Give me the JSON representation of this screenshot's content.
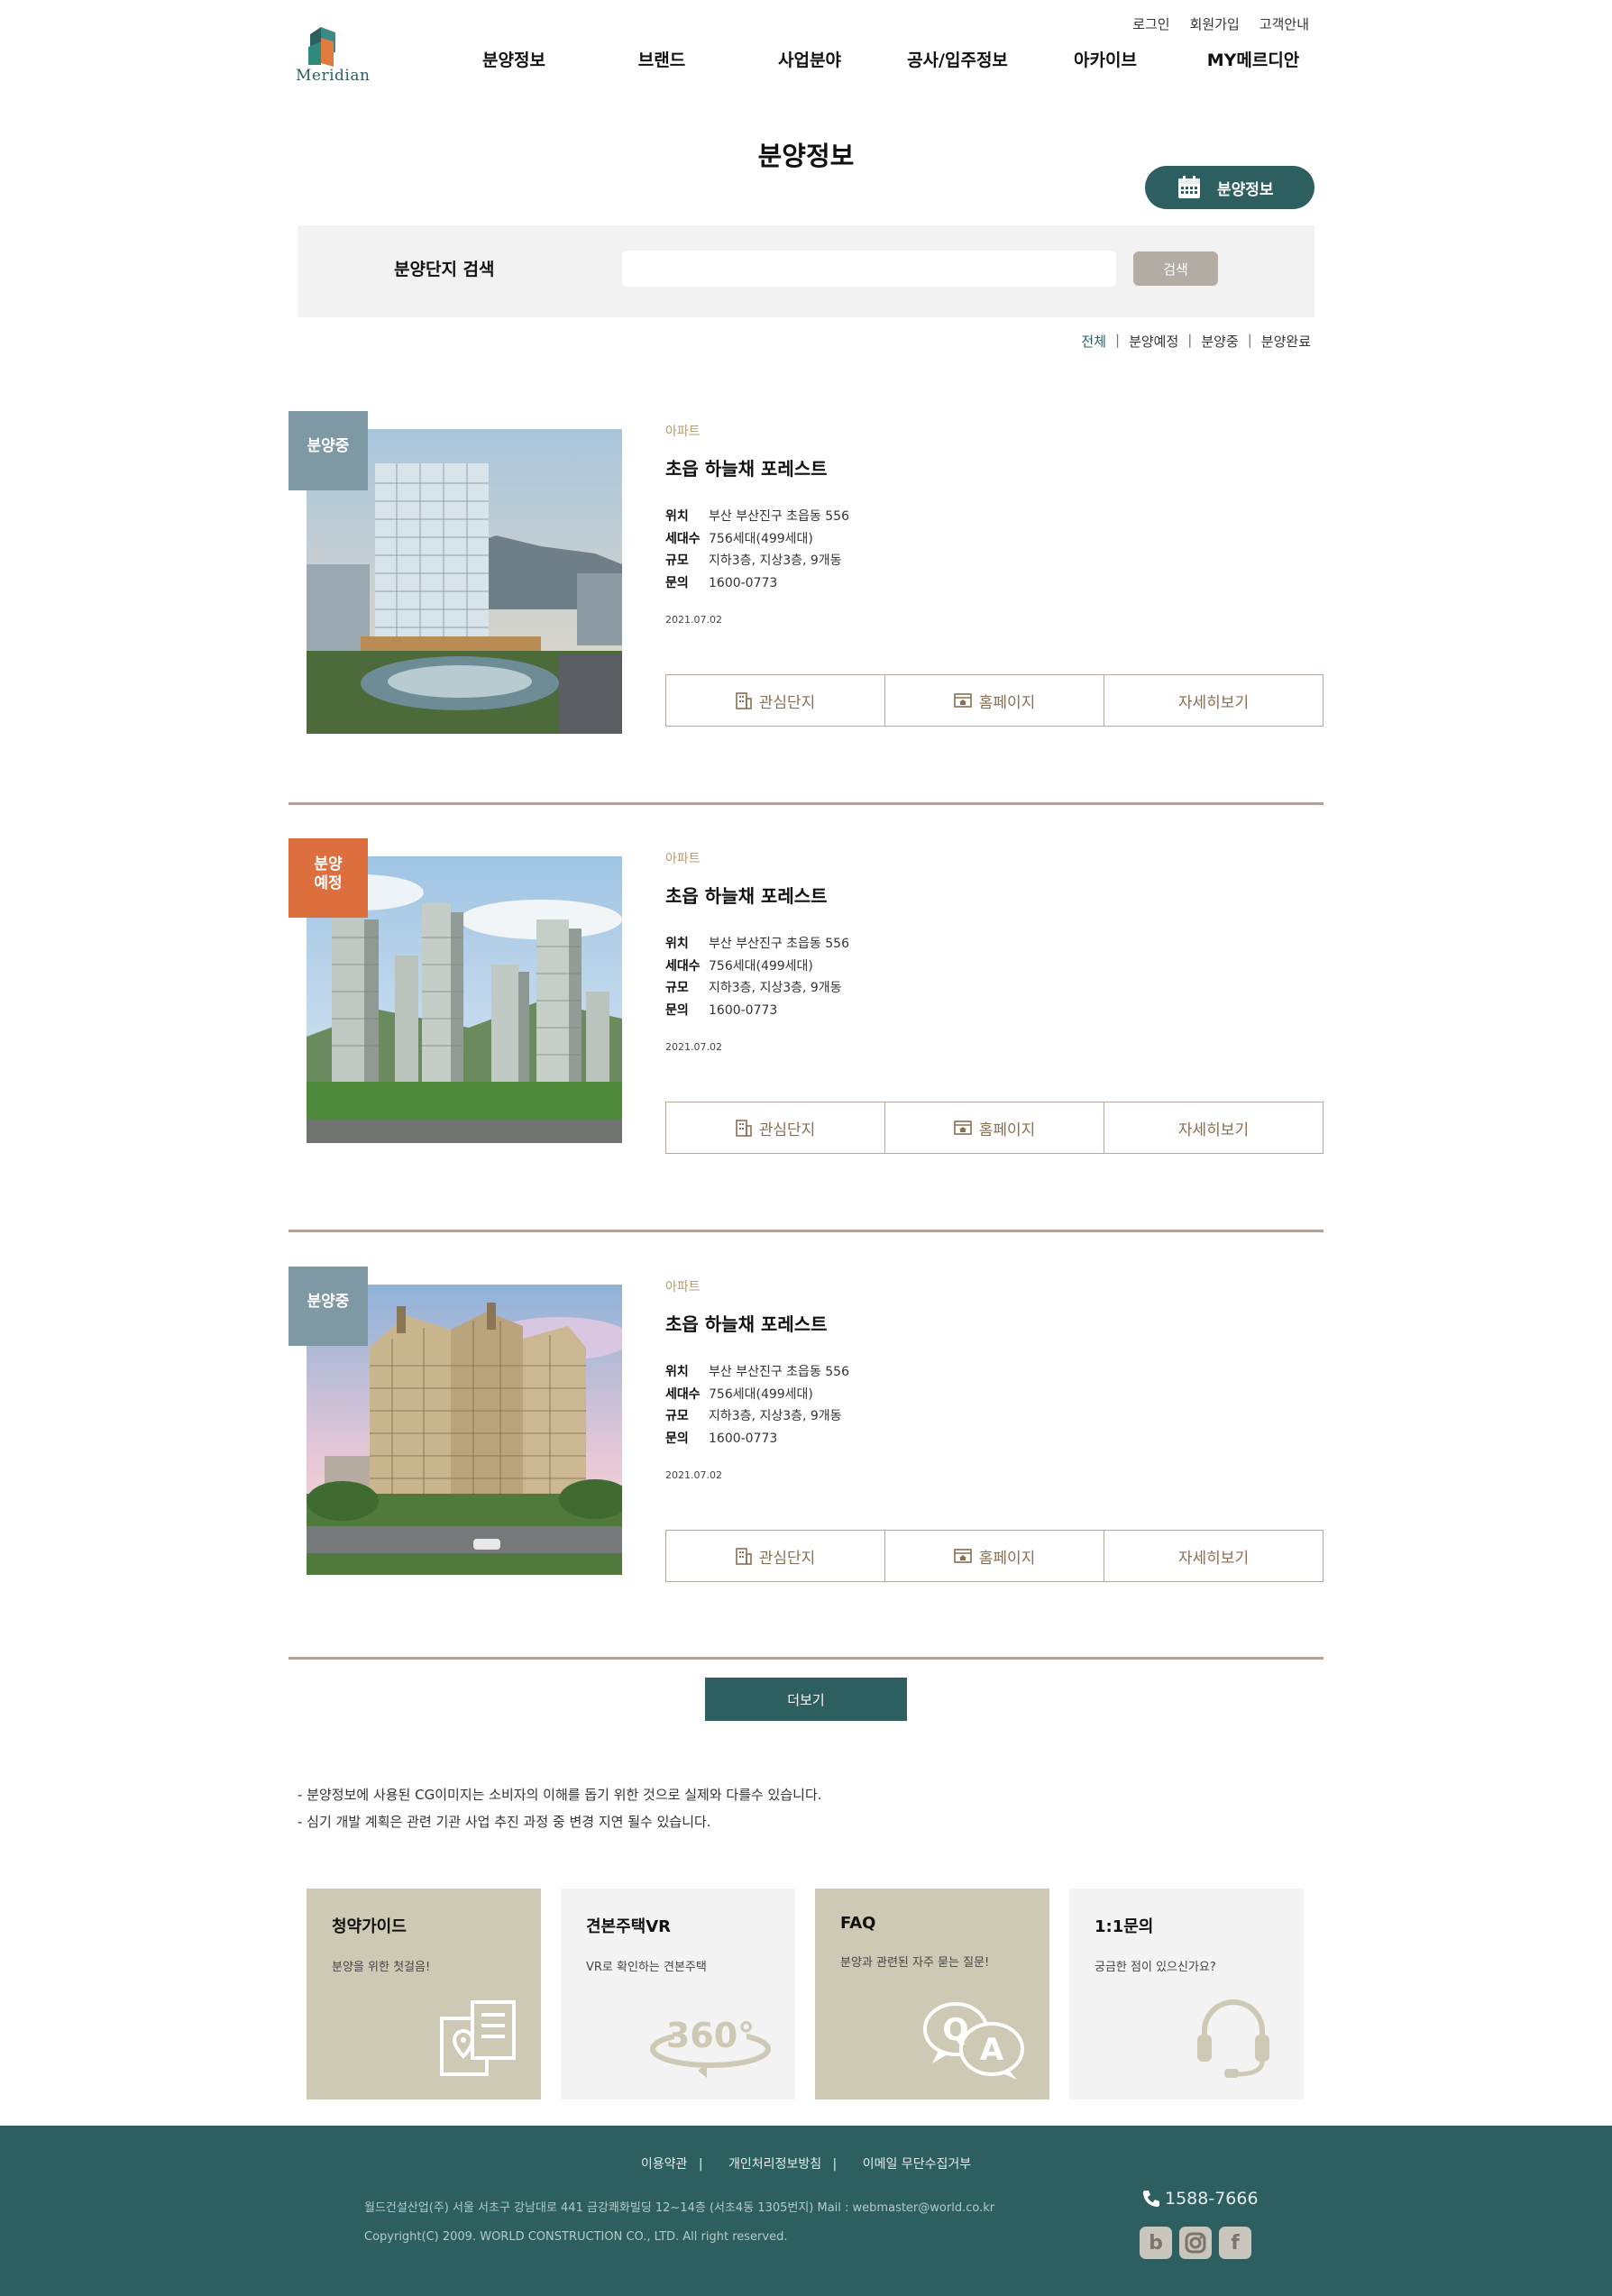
{
  "header": {
    "logo_text": "Meridian",
    "util_links": [
      "로그인",
      "회원가입",
      "고객안내"
    ],
    "nav": [
      "분양정보",
      "브랜드",
      "사업분야",
      "공사/입주정보",
      "아카이브",
      "MY메르디안"
    ]
  },
  "page": {
    "title": "분양정보",
    "pill_label": "분양정보"
  },
  "search": {
    "label": "분양단지 검색",
    "placeholder": "",
    "button": "검색"
  },
  "filters": {
    "items": [
      "전체",
      "분양예정",
      "분양중",
      "분양완료"
    ],
    "active": "전체"
  },
  "listings": [
    {
      "badge": "분양중",
      "type": "아파트",
      "name": "초읍 하늘채 포레스트",
      "spec": {
        "location_label": "위치",
        "location": "부산 부산진구 초읍동 556",
        "units_label": "세대수",
        "units": "756세대(499세대)",
        "scale_label": "규모",
        "scale": "지하3층, 지상3층, 9개동",
        "contact_label": "문의",
        "contact": "1600-0773"
      },
      "date": "2021.07.02",
      "actions": [
        "관심단지",
        "홈페이지",
        "자세히보기"
      ]
    },
    {
      "badge_line1": "분양",
      "badge_line2": "예정",
      "type": "아파트",
      "name": "초읍 하늘채 포레스트",
      "spec": {
        "location_label": "위치",
        "location": "부산 부산진구 초읍동 556",
        "units_label": "세대수",
        "units": "756세대(499세대)",
        "scale_label": "규모",
        "scale": "지하3층, 지상3층, 9개동",
        "contact_label": "문의",
        "contact": "1600-0773"
      },
      "date": "2021.07.02",
      "actions": [
        "관심단지",
        "홈페이지",
        "자세히보기"
      ]
    },
    {
      "badge": "분양중",
      "type": "아파트",
      "name": "초읍 하늘채 포레스트",
      "spec": {
        "location_label": "위치",
        "location": "부산 부산진구 초읍동 556",
        "units_label": "세대수",
        "units": "756세대(499세대)",
        "scale_label": "규모",
        "scale": "지하3층, 지상3층, 9개동",
        "contact_label": "문의",
        "contact": "1600-0773"
      },
      "date": "2021.07.02",
      "actions": [
        "관심단지",
        "홈페이지",
        "자세히보기"
      ]
    }
  ],
  "more_button": "더보기",
  "notes": [
    "- 분양정보에 사용된 CG이미지는 소비자의 이해를 돕기 위한 것으로 실제와 다를수 있습니다.",
    "- 심기 개발 계획은 관련 기관 사업 추진 과정 중 변경 지연 될수 있습니다."
  ],
  "cards": [
    {
      "title": "청약가이드",
      "desc": "분양을 위한 첫걸음!",
      "icon": "guide-map-icon"
    },
    {
      "title": "견본주택VR",
      "desc": "VR로 확인하는 견본주택",
      "icon": "vr-360-icon",
      "icon_text": "360°"
    },
    {
      "title": "FAQ",
      "desc": "분양과 관련된 자주 묻는 질문!",
      "icon": "qa-bubbles-icon",
      "icon_q": "Q",
      "icon_a": "A"
    },
    {
      "title": "1:1문의",
      "desc": "궁금한 점이 있으신가요?",
      "icon": "headset-icon"
    }
  ],
  "footer": {
    "links": [
      "이용약관",
      "개인처리정보방침",
      "이메일 무단수집거부"
    ],
    "address": "월드건설산업(주) 서울 서초구 강남대로 441 금강쾌화빌딩 12~14층 (서초4동 1305번지) Mail : webmaster@world.co.kr",
    "copyright": "Copyright(C) 2009. WORLD CONSTRUCTION CO., LTD. All right reserved.",
    "phone": "1588-7666",
    "social": [
      "blog-icon",
      "instagram-icon",
      "facebook-icon"
    ],
    "social_glyphs": [
      "b",
      "f"
    ]
  },
  "colors": {
    "brand_teal": "#2d5f61",
    "badge_gray": "#7e98a4",
    "badge_orange": "#dd6f3e",
    "card_beige": "#cdc9b4",
    "accent_brown": "#8a6e52"
  }
}
